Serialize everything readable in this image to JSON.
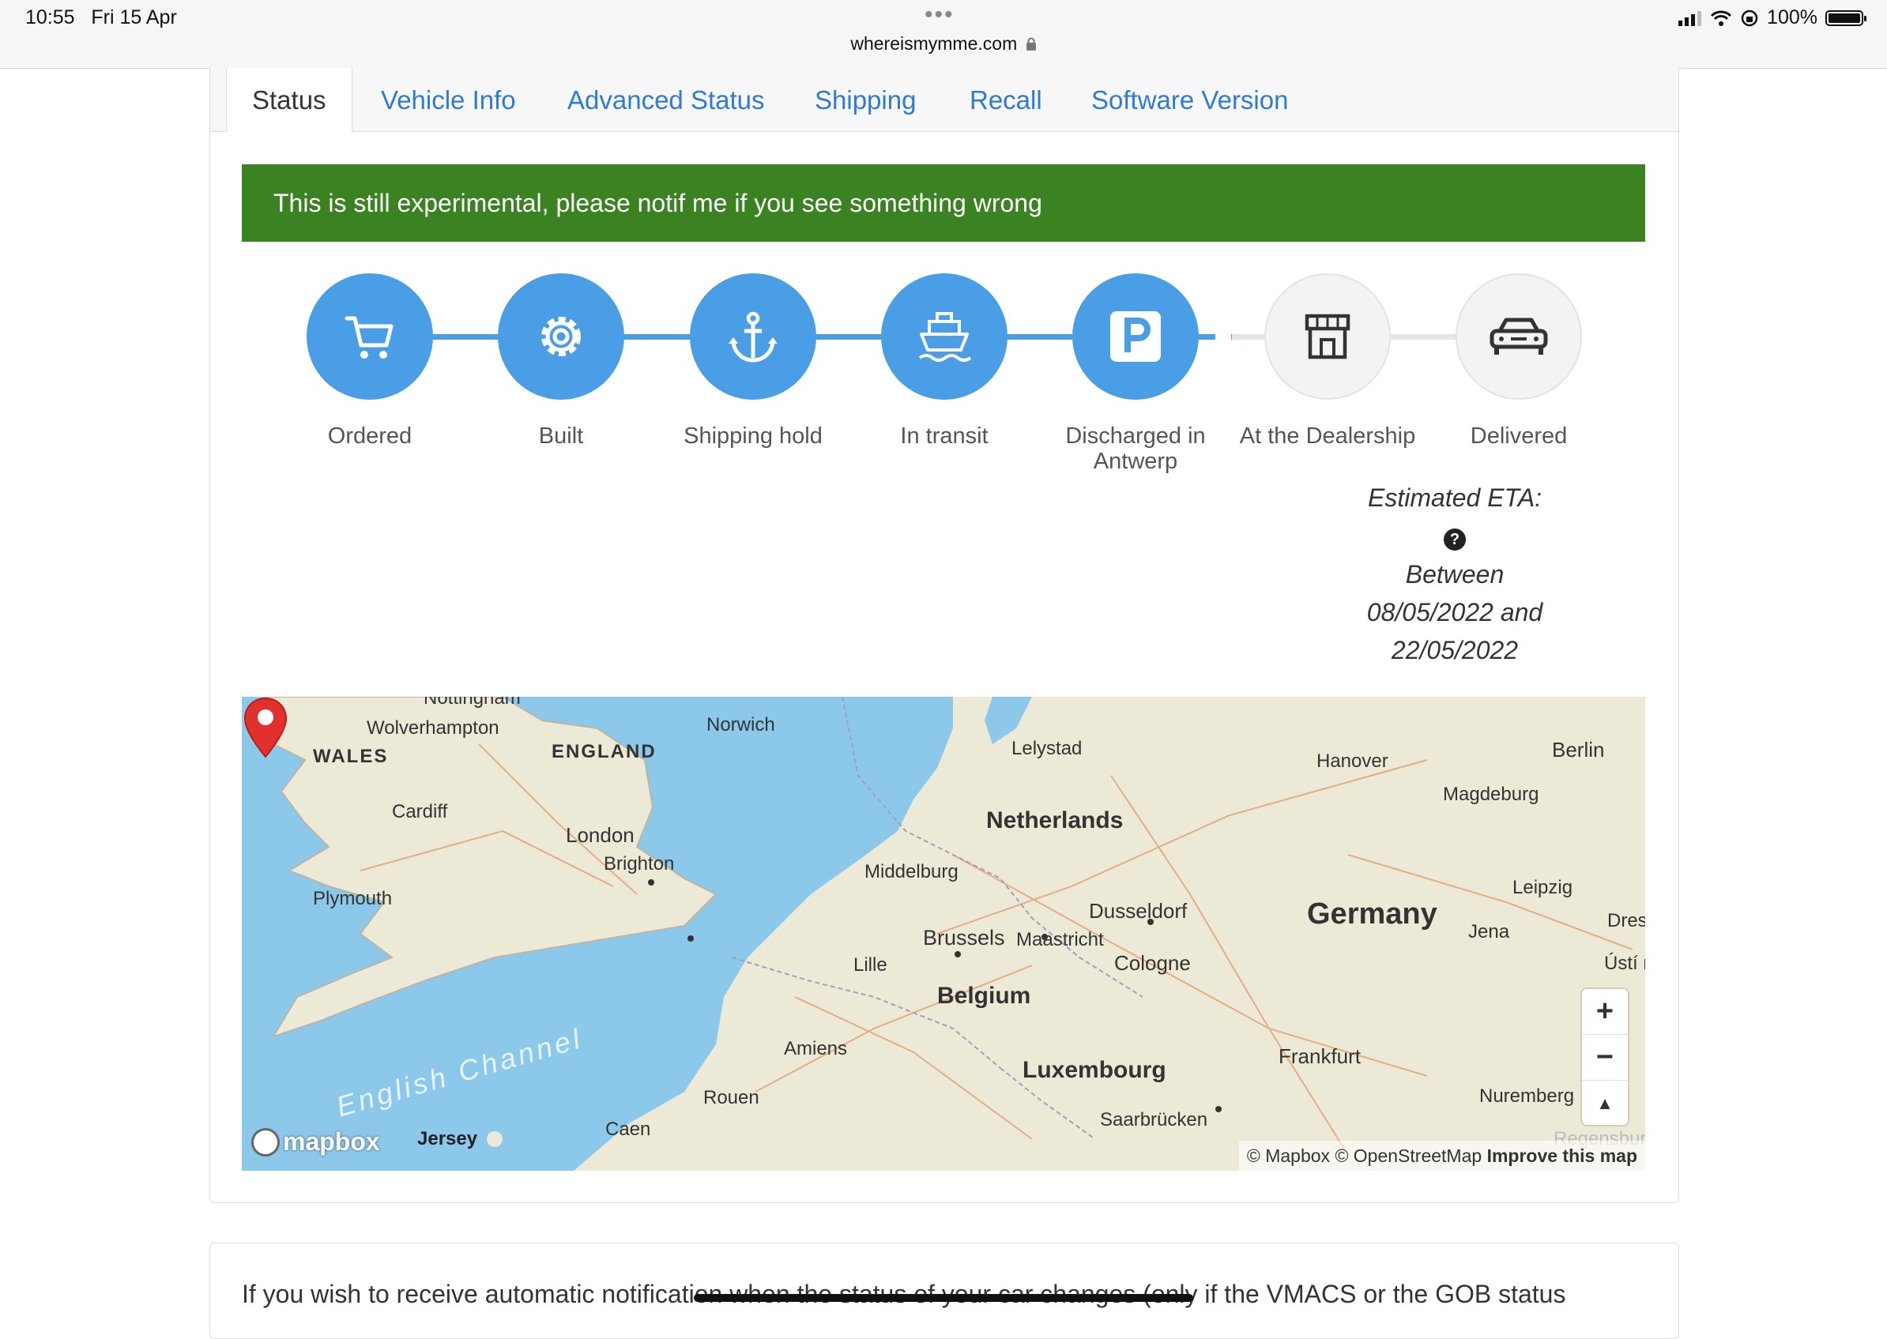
{
  "statusbar": {
    "time": "10:55",
    "date": "Fri 15 Apr",
    "url": "whereismymme.com",
    "battery": "100%"
  },
  "tabs": [
    {
      "label": "Status",
      "active": true
    },
    {
      "label": "Vehicle Info"
    },
    {
      "label": "Advanced Status"
    },
    {
      "label": "Shipping"
    },
    {
      "label": "Recall"
    },
    {
      "label": "Software Version"
    }
  ],
  "alert": "This is still experimental, please notif me if you see something wrong",
  "steps": [
    {
      "label": "Ordered",
      "icon": "cart-icon",
      "done": true
    },
    {
      "label": "Built",
      "icon": "gear-icon",
      "done": true
    },
    {
      "label": "Shipping hold",
      "icon": "anchor-icon",
      "done": true
    },
    {
      "label": "In transit",
      "icon": "ship-icon",
      "done": true
    },
    {
      "label": "Discharged in Antwerp",
      "icon": "parking-icon",
      "done": true
    },
    {
      "label": "At the Dealership",
      "icon": "store-icon",
      "done": false
    },
    {
      "label": "Delivered",
      "icon": "car-icon",
      "done": false
    }
  ],
  "eta": {
    "title": "Estimated ETA:",
    "help": "?",
    "range_line1": "Between",
    "range_line2": "08/05/2022 and",
    "range_line3": "22/05/2022"
  },
  "map": {
    "labels": {
      "nottingham": "Nottingham",
      "wolverhampton": "Wolverhampton",
      "norwich": "Norwich",
      "wales": "WALES",
      "england": "ENGLAND",
      "cardiff": "Cardiff",
      "london": "London",
      "brighton": "Brighton",
      "plymouth": "Plymouth",
      "channel": "English Channel",
      "jersey": "Jersey",
      "caen": "Caen",
      "rouen": "Rouen",
      "amiens": "Amiens",
      "lille": "Lille",
      "middelburg": "Middelburg",
      "lelystad": "Lelystad",
      "netherlands": "Netherlands",
      "brussels": "Brussels",
      "maastricht": "Maastricht",
      "belgium": "Belgium",
      "luxembourg": "Luxembourg",
      "saarbrucken": "Saarbrücken",
      "dusseldorf": "Dusseldorf",
      "cologne": "Cologne",
      "frankfurt": "Frankfurt",
      "hanover": "Hanover",
      "germany": "Germany",
      "magdeburg": "Magdeburg",
      "berlin": "Berlin",
      "leipzig": "Leipzig",
      "jena": "Jena",
      "dresden": "Dres",
      "usti": "Ústí n",
      "nuremberg": "Nuremberg",
      "regensburg": "Regensburg"
    },
    "zoom_in": "+",
    "zoom_out": "−",
    "compass": "▲",
    "logo_text": "mapbox",
    "attribution_mapbox": "© Mapbox",
    "attribution_osm": "© OpenStreetMap",
    "attribution_improve": "Improve this map"
  },
  "notify_text": "If you wish to receive automatic notification when the status of your car changes (only if the VMACS or the GOB status",
  "colors": {
    "accent_blue": "#4a9ee6",
    "tab_link": "#2f7bd3",
    "alert_green": "#3a8222",
    "sea": "#8cc8ea",
    "land": "#ece9d6",
    "pin_red": "#e2312d"
  }
}
